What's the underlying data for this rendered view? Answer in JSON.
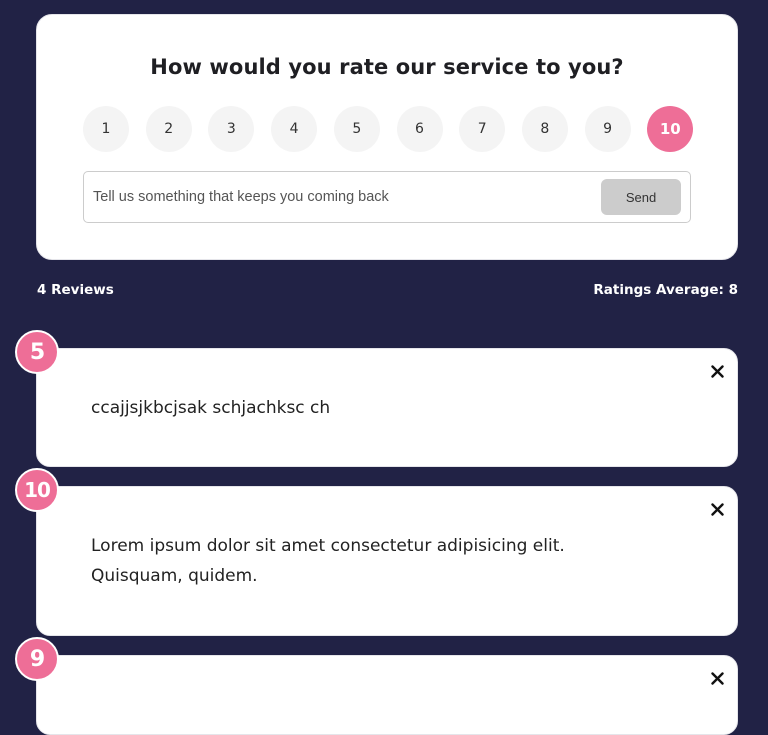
{
  "feedback_form": {
    "title": "How would you rate our service to you?",
    "rating_options": [
      "1",
      "2",
      "3",
      "4",
      "5",
      "6",
      "7",
      "8",
      "9",
      "10"
    ],
    "selected_rating": "10",
    "review_input": {
      "value": "",
      "placeholder": "Tell us something that keeps you coming back"
    },
    "send_label": "Send"
  },
  "stats": {
    "reviews_count_text": "4 Reviews",
    "average_text": "Ratings Average: 8"
  },
  "reviews": [
    {
      "rating": "5",
      "text": "ccajjsjkbcjsak schjachksc ch"
    },
    {
      "rating": "10",
      "text": "Lorem ipsum dolor sit amet consectetur adipisicing elit. Quisquam, quidem."
    },
    {
      "rating": "9",
      "text": ""
    }
  ],
  "colors": {
    "background": "#212245",
    "accent": "#ee6e97",
    "card": "#ffffff",
    "send_button": "#cccccc",
    "rating_option": "#f4f4f4"
  },
  "icons": {
    "close": "close-icon"
  }
}
